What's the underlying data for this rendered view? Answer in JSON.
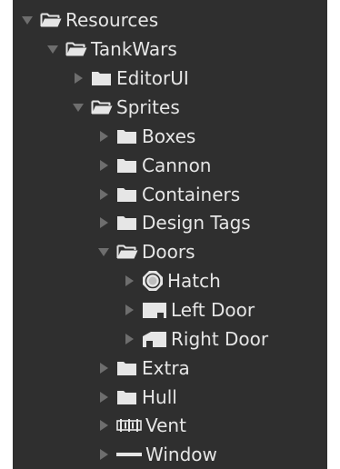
{
  "tree": {
    "items": [
      {
        "label": "Resources",
        "icon": "folder-open-icon",
        "arrow": "expanded",
        "depth": 0
      },
      {
        "label": "TankWars",
        "icon": "folder-open-icon",
        "arrow": "expanded",
        "depth": 1
      },
      {
        "label": "EditorUI",
        "icon": "folder-closed-icon",
        "arrow": "collapsed",
        "depth": 2
      },
      {
        "label": "Sprites",
        "icon": "folder-open-icon",
        "arrow": "expanded",
        "depth": 2
      },
      {
        "label": "Boxes",
        "icon": "folder-closed-icon",
        "arrow": "collapsed",
        "depth": 3
      },
      {
        "label": "Cannon",
        "icon": "folder-closed-icon",
        "arrow": "collapsed",
        "depth": 3
      },
      {
        "label": "Containers",
        "icon": "folder-closed-icon",
        "arrow": "collapsed",
        "depth": 3
      },
      {
        "label": "Design Tags",
        "icon": "folder-closed-icon",
        "arrow": "collapsed",
        "depth": 3
      },
      {
        "label": "Doors",
        "icon": "folder-open-icon",
        "arrow": "expanded",
        "depth": 3
      },
      {
        "label": "Hatch",
        "icon": "hatch-sprite-icon",
        "arrow": "collapsed",
        "depth": 4
      },
      {
        "label": "Left Door",
        "icon": "left-door-sprite-icon",
        "arrow": "collapsed",
        "depth": 4
      },
      {
        "label": "Right Door",
        "icon": "right-door-sprite-icon",
        "arrow": "collapsed",
        "depth": 4
      },
      {
        "label": "Extra",
        "icon": "folder-closed-icon",
        "arrow": "collapsed",
        "depth": 3
      },
      {
        "label": "Hull",
        "icon": "folder-closed-icon",
        "arrow": "collapsed",
        "depth": 3
      },
      {
        "label": "Vent",
        "icon": "vent-sprite-icon",
        "arrow": "collapsed",
        "depth": 3
      },
      {
        "label": "Window",
        "icon": "window-sprite-icon",
        "arrow": "collapsed",
        "depth": 3
      }
    ]
  },
  "colors": {
    "background": "#2f2f2f",
    "text": "#e6e6e6",
    "arrow": "#6e6e6e",
    "icon": "#e6e6e6"
  }
}
